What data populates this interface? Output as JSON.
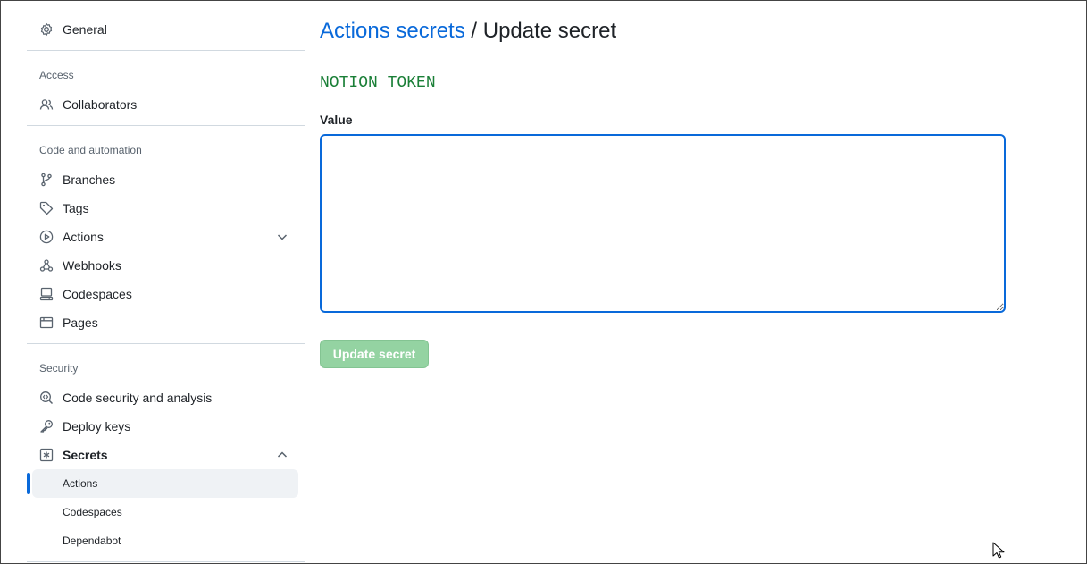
{
  "sidebar": {
    "general": "General",
    "sections": {
      "access": "Access",
      "code_automation": "Code and automation",
      "security": "Security"
    },
    "items": {
      "collaborators": "Collaborators",
      "branches": "Branches",
      "tags": "Tags",
      "actions": "Actions",
      "webhooks": "Webhooks",
      "codespaces": "Codespaces",
      "pages": "Pages",
      "code_security": "Code security and analysis",
      "deploy_keys": "Deploy keys",
      "secrets": "Secrets"
    },
    "secrets_sub": {
      "actions": "Actions",
      "codespaces": "Codespaces",
      "dependabot": "Dependabot"
    }
  },
  "main": {
    "breadcrumb_link": "Actions secrets",
    "breadcrumb_sep": " / ",
    "breadcrumb_current": "Update secret",
    "secret_name": "NOTION_TOKEN",
    "value_label": "Value",
    "value": "",
    "submit_label": "Update secret"
  },
  "colors": {
    "link": "#0969da",
    "secret_name": "#1a7f37",
    "button_disabled": "#94d3a2"
  }
}
